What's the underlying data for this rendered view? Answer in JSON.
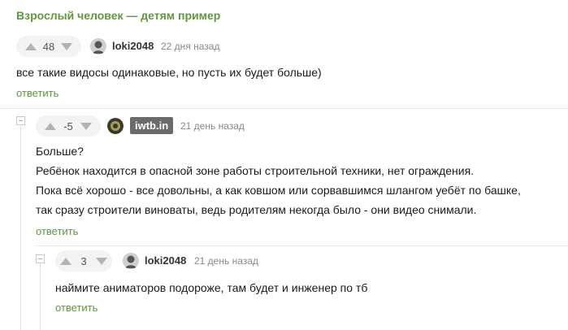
{
  "post_title": "Взрослый человек — детям пример",
  "comments": [
    {
      "score": "48",
      "username": "loki2048",
      "date": "22 дня назад",
      "lines": [
        "все такие видосы одинаковые, но пусть их будет больше)"
      ],
      "reply_label": "ответить"
    },
    {
      "score": "-5",
      "username": "iwtb.in",
      "date": "21 день назад",
      "lines": [
        "Больше?",
        "Ребёнок находится в опасной зоне работы строительной техники, нет ограждения.",
        "Пока всё хорошо - все довольны, а как ковшом или сорвавшимся шлангом уебёт по башке,",
        "так сразу строители виноваты, ведь родителям некогда было - они видео снимали."
      ],
      "reply_label": "ответить"
    },
    {
      "score": "3",
      "username": "loki2048",
      "date": "21 день назад",
      "lines": [
        "наймите аниматоров подороже, там будет и инженер по тб"
      ],
      "reply_label": "ответить"
    }
  ],
  "icons": {
    "upvote": "upvote-arrow-icon",
    "downvote": "downvote-arrow-icon",
    "collapse": "collapse-minus-icon"
  },
  "colors": {
    "accent": "#5b9a3a",
    "muted": "#888888",
    "vote_pill": "#f3f3f3"
  }
}
